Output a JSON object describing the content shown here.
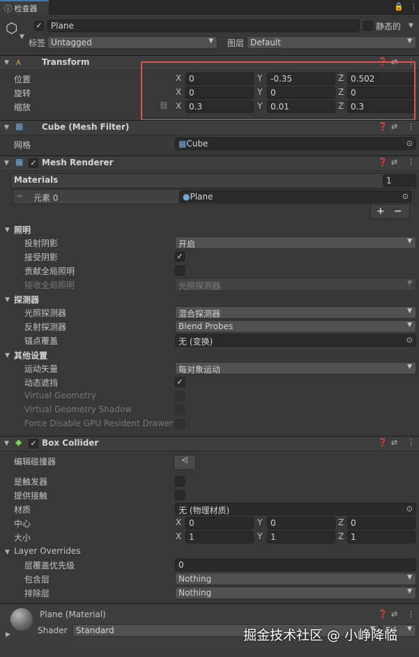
{
  "tab": {
    "title": "检查器",
    "lock_icon": "lock-icon",
    "menu_icon": "more-icon"
  },
  "object": {
    "name": "Plane",
    "static_label": "静态的",
    "tag_label": "标签",
    "tag_value": "Untagged",
    "layer_label": "图层",
    "layer_value": "Default"
  },
  "transform": {
    "title": "Transform",
    "position_label": "位置",
    "rotation_label": "旋转",
    "scale_label": "缩放",
    "x": "X",
    "y": "Y",
    "z": "Z",
    "position": {
      "x": "0",
      "y": "-0.35",
      "z": "0.502"
    },
    "rotation": {
      "x": "0",
      "y": "0",
      "z": "0"
    },
    "scale": {
      "x": "0.3",
      "y": "0.01",
      "z": "0.3"
    }
  },
  "mesh_filter": {
    "title": "Cube (Mesh Filter)",
    "mesh_label": "网格",
    "mesh_value": "Cube"
  },
  "mesh_renderer": {
    "title": "Mesh Renderer",
    "materials_label": "Materials",
    "materials_count": "1",
    "element_label": "元素 0",
    "element_value": "Plane",
    "add": "+",
    "remove": "−",
    "lighting": {
      "title": "照明",
      "cast_shadows_label": "投射阴影",
      "cast_shadows_value": "开启",
      "receive_shadows_label": "接受阴影",
      "contribute_gi_label": "贡献全局照明",
      "receive_gi_label": "接收全局照明",
      "receive_gi_value": "光照探测器"
    },
    "probes": {
      "title": "探测器",
      "light_probes_label": "光照探测器",
      "light_probes_value": "混合探测器",
      "reflection_probes_label": "反射探测器",
      "reflection_probes_value": "Blend Probes",
      "anchor_label": "锚点覆盖",
      "anchor_value": "无 (变换)"
    },
    "additional": {
      "title": "其他设置",
      "motion_label": "运动矢量",
      "motion_value": "每对象运动",
      "dynamic_occlusion_label": "动态遮挡",
      "vg_label": "Virtual Geometry",
      "vgs_label": "Virtual Geometry Shadow",
      "gpu_label": "Force Disable GPU Resident Drawer"
    }
  },
  "box_collider": {
    "title": "Box Collider",
    "edit_label": "编辑碰撞器",
    "trigger_label": "是触发器",
    "contacts_label": "提供接触",
    "material_label": "材质",
    "material_value": "无 (物理材质)",
    "center_label": "中心",
    "size_label": "大小",
    "center": {
      "x": "0",
      "y": "0",
      "z": "0"
    },
    "size": {
      "x": "1",
      "y": "1",
      "z": "1"
    },
    "layer_overrides_label": "Layer Overrides",
    "priority_label": "层覆盖优先级",
    "priority_value": "0",
    "include_label": "包含层",
    "include_value": "Nothing",
    "exclude_label": "排除层",
    "exclude_value": "Nothing"
  },
  "material": {
    "title": "Plane (Material)",
    "shader_label": "Shader",
    "shader_value": "Standard",
    "edit_label": "Ed"
  },
  "watermark": "掘金技术社区 @ 小峥降临"
}
